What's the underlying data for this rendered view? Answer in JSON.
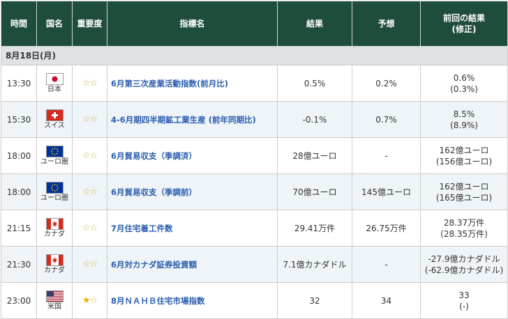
{
  "headers": [
    "時間",
    "国名",
    "重要度",
    "指標名",
    "結果",
    "予想",
    "前回の結果\n(修正)"
  ],
  "date": "8月18日(月)",
  "rows": [
    {
      "time": "13:30",
      "country": "日本",
      "flag": "jp",
      "stars": [
        0,
        0
      ],
      "name": "6月第三次産業活動指数(前月比)",
      "result": "0.5%",
      "forecast": "0.2%",
      "prev": "0.6%",
      "prev_rev": "(0.3%)"
    },
    {
      "time": "15:30",
      "country": "スイス",
      "flag": "ch",
      "stars": [
        0,
        0
      ],
      "name": "4-6月期四半期鉱工業生産 (前年同期比)",
      "result": "-0.1%",
      "forecast": "0.7%",
      "prev": "8.5%",
      "prev_rev": "(8.9%)"
    },
    {
      "time": "18:00",
      "country": "ユーロ圏",
      "flag": "eu",
      "stars": [
        0,
        0
      ],
      "name": "6月貿易収支（季調済）",
      "result": "28億ユーロ",
      "forecast": "-",
      "prev": "162億ユーロ",
      "prev_rev": "(156億ユーロ)"
    },
    {
      "time": "18:00",
      "country": "ユーロ圏",
      "flag": "eu",
      "stars": [
        0,
        0
      ],
      "name": "6月貿易収支（季調前）",
      "result": "70億ユーロ",
      "forecast": "145億ユーロ",
      "prev": "162億ユーロ",
      "prev_rev": "(165億ユーロ)"
    },
    {
      "time": "21:15",
      "country": "カナダ",
      "flag": "ca",
      "stars": [
        0,
        0
      ],
      "name": "7月住宅着工件数",
      "result": "29.41万件",
      "forecast": "26.75万件",
      "prev": "28.37万件",
      "prev_rev": "(28.35万件)"
    },
    {
      "time": "21:30",
      "country": "カナダ",
      "flag": "ca",
      "stars": [
        0,
        0
      ],
      "name": "6月対カナダ証券投資額",
      "result": "7.1億カナダドル",
      "forecast": "-",
      "prev": "-27.9億カナダドル",
      "prev_rev": "(-62.9億カナダドル)"
    },
    {
      "time": "23:00",
      "country": "米国",
      "flag": "us",
      "stars": [
        1,
        0
      ],
      "name": "8月ＮＡＨＢ住宅市場指数",
      "result": "32",
      "forecast": "34",
      "prev": "33",
      "prev_rev": "(-)"
    }
  ],
  "colors": {
    "header_bg": "#1f4d3b",
    "date_bg": "#dfe3e6",
    "alt_row_bg": "#eef4f7",
    "link": "#2a5db0",
    "star": "#e6b800"
  }
}
